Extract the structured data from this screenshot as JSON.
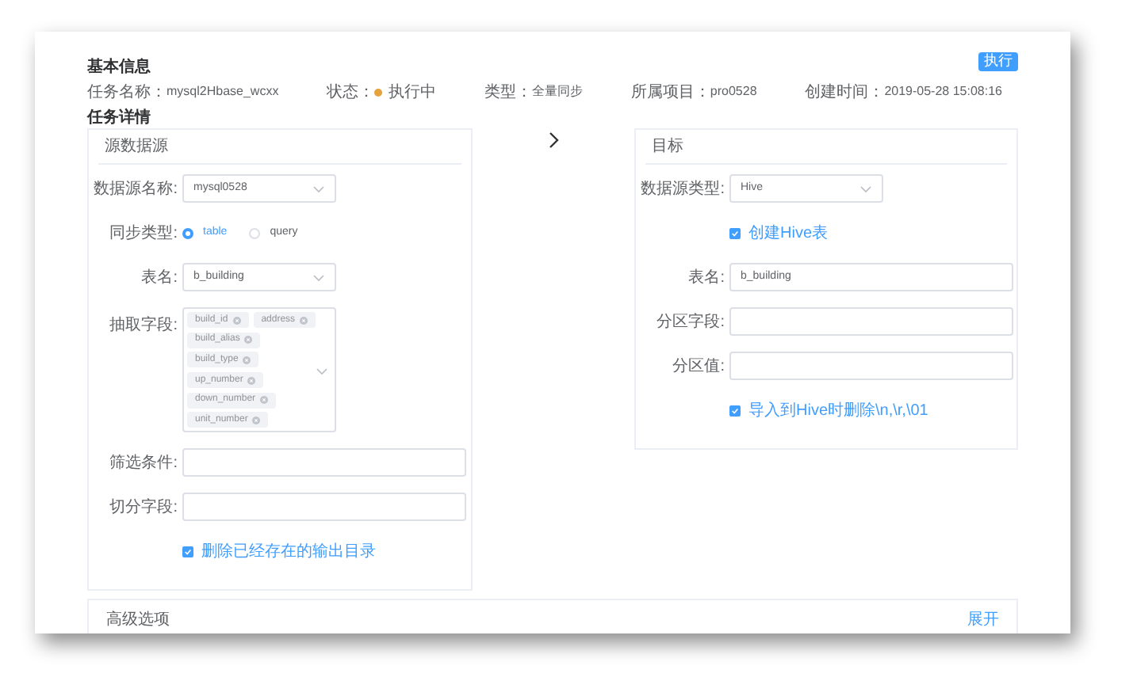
{
  "basic_info": {
    "title": "基本信息",
    "execute_button": "执行",
    "fields": [
      {
        "kind": "text",
        "label": "任务名称：",
        "value": "mysql2Hbase_wcxx"
      },
      {
        "kind": "status",
        "label": "状态：",
        "value": "执行中",
        "color": "#e6a23c"
      },
      {
        "kind": "text",
        "label": "类型：",
        "value": "全量同步"
      },
      {
        "kind": "text",
        "label": "所属项目：",
        "value": "pro0528"
      },
      {
        "kind": "text",
        "label": "创建时间：",
        "value": "2019-05-28 15:08:16"
      }
    ]
  },
  "task_details": {
    "title": "任务详情",
    "source": {
      "title": "源数据源",
      "rows": [
        {
          "kind": "select",
          "label": "数据源名称:",
          "value": "mysql0528"
        },
        {
          "kind": "radio",
          "label": "同步类型:",
          "options": [
            {
              "label": "table",
              "selected": true
            },
            {
              "label": "query",
              "selected": false
            }
          ]
        },
        {
          "kind": "select",
          "label": "表名:",
          "value": "b_building"
        },
        {
          "kind": "tags",
          "label": "抽取字段:",
          "tags": [
            "build_id",
            "address",
            "build_alias",
            "build_type",
            "up_number",
            "down_number",
            "unit_number"
          ]
        },
        {
          "kind": "input",
          "label": "筛选条件:"
        },
        {
          "kind": "input",
          "label": "切分字段:"
        },
        {
          "kind": "checkbox",
          "label": "删除已经存在的输出目录",
          "checked": true
        }
      ]
    },
    "target": {
      "title": "目标",
      "rows": [
        {
          "kind": "select",
          "label": "数据源类型:",
          "value": "Hive"
        },
        {
          "kind": "checkbox",
          "label": "创建Hive表",
          "checked": true
        },
        {
          "kind": "input",
          "label": "表名:",
          "value": "b_building"
        },
        {
          "kind": "input",
          "label": "分区字段:"
        },
        {
          "kind": "input",
          "label": "分区值:"
        },
        {
          "kind": "checkbox",
          "label": "导入到Hive时删除\\n,\\r,\\01",
          "checked": true
        }
      ]
    }
  },
  "advanced": {
    "title": "高级选项",
    "toggle": "展开"
  }
}
